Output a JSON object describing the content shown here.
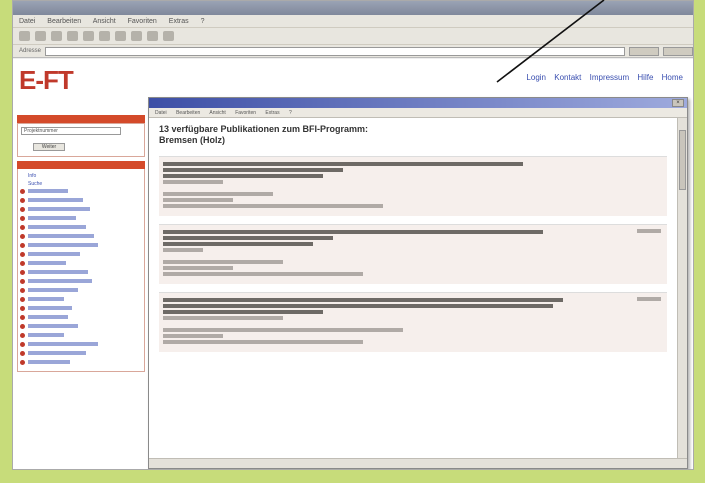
{
  "browser": {
    "menu_items": [
      "Datei",
      "Bearbeiten",
      "Ansicht",
      "Favoriten",
      "Extras",
      "?"
    ],
    "address_label": "Adresse"
  },
  "site": {
    "logo_text": "E-FT",
    "top_links": [
      "Login",
      "Kontakt",
      "Impressum",
      "Hilfe",
      "Home"
    ]
  },
  "sidebar": {
    "search_select": "Projektnummer",
    "search_button": "Weiter",
    "list_links": [
      "Info",
      "Suche"
    ]
  },
  "popup": {
    "menu_items": [
      "Datei",
      "Bearbeiten",
      "Ansicht",
      "Favoriten",
      "Extras",
      "?"
    ],
    "heading_line1": "13 verfügbare Publikationen zum BFI-Programm:",
    "heading_line2": "Bremsen (Holz)"
  },
  "colors": {
    "background": "#c7dc7a",
    "sidebar_header": "#d44a2a",
    "popup_title_gradient_start": "#3d4fa6",
    "link": "#3a4fb0"
  }
}
